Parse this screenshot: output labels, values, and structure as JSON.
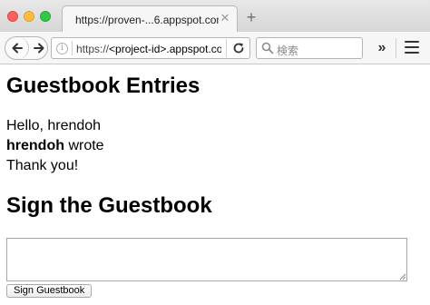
{
  "browser": {
    "tab_title": "https://proven-...6.appspot.com/",
    "tab_close": "✕",
    "new_tab": "+",
    "url_prefix": "https://",
    "url_host": "<project-id>.appspot.com",
    "search_placeholder": "検索",
    "overflow": "»"
  },
  "page": {
    "entries_heading": "Guestbook Entries",
    "greeting": "Hello, hrendoh",
    "entries": [
      {
        "author": "hrendoh",
        "verb": " wrote",
        "content": "Thank you!"
      }
    ],
    "sign_heading": "Sign the Guestbook",
    "sign_button": "Sign Guestbook"
  },
  "colors": {
    "close_red": "#fc605c",
    "minimize_yellow": "#fdbc40",
    "zoom_green": "#34c84a"
  }
}
